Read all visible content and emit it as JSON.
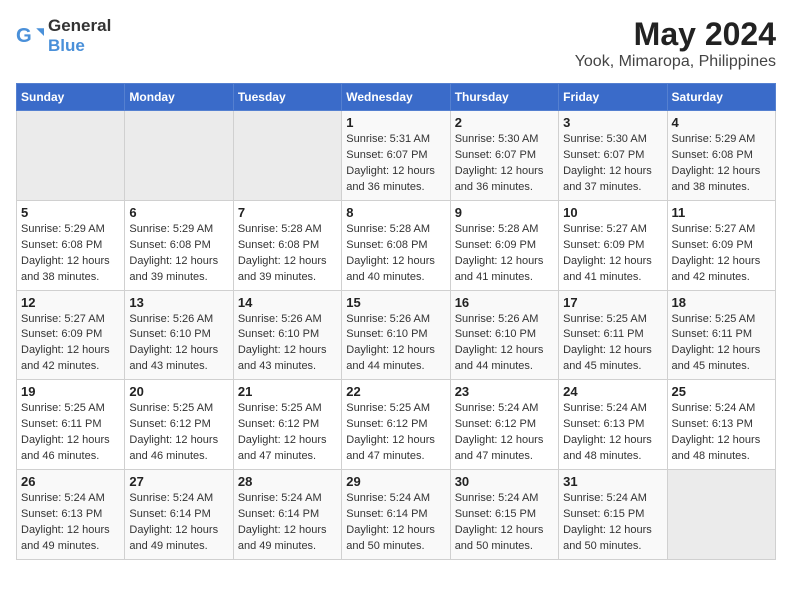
{
  "logo": {
    "general": "General",
    "blue": "Blue"
  },
  "title": "May 2024",
  "subtitle": "Yook, Mimaropa, Philippines",
  "days_header": [
    "Sunday",
    "Monday",
    "Tuesday",
    "Wednesday",
    "Thursday",
    "Friday",
    "Saturday"
  ],
  "weeks": [
    [
      {
        "num": "",
        "info": ""
      },
      {
        "num": "",
        "info": ""
      },
      {
        "num": "",
        "info": ""
      },
      {
        "num": "1",
        "info": "Sunrise: 5:31 AM\nSunset: 6:07 PM\nDaylight: 12 hours\nand 36 minutes."
      },
      {
        "num": "2",
        "info": "Sunrise: 5:30 AM\nSunset: 6:07 PM\nDaylight: 12 hours\nand 36 minutes."
      },
      {
        "num": "3",
        "info": "Sunrise: 5:30 AM\nSunset: 6:07 PM\nDaylight: 12 hours\nand 37 minutes."
      },
      {
        "num": "4",
        "info": "Sunrise: 5:29 AM\nSunset: 6:08 PM\nDaylight: 12 hours\nand 38 minutes."
      }
    ],
    [
      {
        "num": "5",
        "info": "Sunrise: 5:29 AM\nSunset: 6:08 PM\nDaylight: 12 hours\nand 38 minutes."
      },
      {
        "num": "6",
        "info": "Sunrise: 5:29 AM\nSunset: 6:08 PM\nDaylight: 12 hours\nand 39 minutes."
      },
      {
        "num": "7",
        "info": "Sunrise: 5:28 AM\nSunset: 6:08 PM\nDaylight: 12 hours\nand 39 minutes."
      },
      {
        "num": "8",
        "info": "Sunrise: 5:28 AM\nSunset: 6:08 PM\nDaylight: 12 hours\nand 40 minutes."
      },
      {
        "num": "9",
        "info": "Sunrise: 5:28 AM\nSunset: 6:09 PM\nDaylight: 12 hours\nand 41 minutes."
      },
      {
        "num": "10",
        "info": "Sunrise: 5:27 AM\nSunset: 6:09 PM\nDaylight: 12 hours\nand 41 minutes."
      },
      {
        "num": "11",
        "info": "Sunrise: 5:27 AM\nSunset: 6:09 PM\nDaylight: 12 hours\nand 42 minutes."
      }
    ],
    [
      {
        "num": "12",
        "info": "Sunrise: 5:27 AM\nSunset: 6:09 PM\nDaylight: 12 hours\nand 42 minutes."
      },
      {
        "num": "13",
        "info": "Sunrise: 5:26 AM\nSunset: 6:10 PM\nDaylight: 12 hours\nand 43 minutes."
      },
      {
        "num": "14",
        "info": "Sunrise: 5:26 AM\nSunset: 6:10 PM\nDaylight: 12 hours\nand 43 minutes."
      },
      {
        "num": "15",
        "info": "Sunrise: 5:26 AM\nSunset: 6:10 PM\nDaylight: 12 hours\nand 44 minutes."
      },
      {
        "num": "16",
        "info": "Sunrise: 5:26 AM\nSunset: 6:10 PM\nDaylight: 12 hours\nand 44 minutes."
      },
      {
        "num": "17",
        "info": "Sunrise: 5:25 AM\nSunset: 6:11 PM\nDaylight: 12 hours\nand 45 minutes."
      },
      {
        "num": "18",
        "info": "Sunrise: 5:25 AM\nSunset: 6:11 PM\nDaylight: 12 hours\nand 45 minutes."
      }
    ],
    [
      {
        "num": "19",
        "info": "Sunrise: 5:25 AM\nSunset: 6:11 PM\nDaylight: 12 hours\nand 46 minutes."
      },
      {
        "num": "20",
        "info": "Sunrise: 5:25 AM\nSunset: 6:12 PM\nDaylight: 12 hours\nand 46 minutes."
      },
      {
        "num": "21",
        "info": "Sunrise: 5:25 AM\nSunset: 6:12 PM\nDaylight: 12 hours\nand 47 minutes."
      },
      {
        "num": "22",
        "info": "Sunrise: 5:25 AM\nSunset: 6:12 PM\nDaylight: 12 hours\nand 47 minutes."
      },
      {
        "num": "23",
        "info": "Sunrise: 5:24 AM\nSunset: 6:12 PM\nDaylight: 12 hours\nand 47 minutes."
      },
      {
        "num": "24",
        "info": "Sunrise: 5:24 AM\nSunset: 6:13 PM\nDaylight: 12 hours\nand 48 minutes."
      },
      {
        "num": "25",
        "info": "Sunrise: 5:24 AM\nSunset: 6:13 PM\nDaylight: 12 hours\nand 48 minutes."
      }
    ],
    [
      {
        "num": "26",
        "info": "Sunrise: 5:24 AM\nSunset: 6:13 PM\nDaylight: 12 hours\nand 49 minutes."
      },
      {
        "num": "27",
        "info": "Sunrise: 5:24 AM\nSunset: 6:14 PM\nDaylight: 12 hours\nand 49 minutes."
      },
      {
        "num": "28",
        "info": "Sunrise: 5:24 AM\nSunset: 6:14 PM\nDaylight: 12 hours\nand 49 minutes."
      },
      {
        "num": "29",
        "info": "Sunrise: 5:24 AM\nSunset: 6:14 PM\nDaylight: 12 hours\nand 50 minutes."
      },
      {
        "num": "30",
        "info": "Sunrise: 5:24 AM\nSunset: 6:15 PM\nDaylight: 12 hours\nand 50 minutes."
      },
      {
        "num": "31",
        "info": "Sunrise: 5:24 AM\nSunset: 6:15 PM\nDaylight: 12 hours\nand 50 minutes."
      },
      {
        "num": "",
        "info": ""
      }
    ]
  ]
}
